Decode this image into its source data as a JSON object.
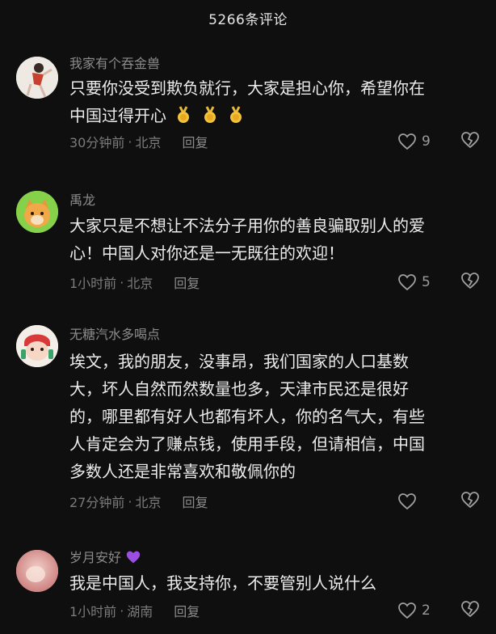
{
  "header": {
    "title": "5266条评论"
  },
  "comments": [
    {
      "username": "我家有个吞金兽",
      "lines": [
        "只要你没受到欺负就行，大家是担心你，希望你在",
        "中国过得开心"
      ],
      "time": "30分钟前",
      "location": "北京",
      "reply": "回复",
      "likes": "9",
      "emoji": "gold-medal-icon x3"
    },
    {
      "username": "禹龙",
      "lines": [
        "大家只是不想让不法分子用你的善良骗取别人的爱",
        "心！中国人对你还是一无既往的欢迎！"
      ],
      "time": "1小时前",
      "location": "北京",
      "reply": "回复",
      "likes": "5"
    },
    {
      "username": "无糖汽水多喝点",
      "lines": [
        "埃文，我的朋友，没事昂，我们国家的人口基数",
        "大，坏人自然而然数量也多，天津市民还是很好",
        "的，哪里都有好人也都有坏人，你的名气大，有些",
        "人肯定会为了赚点钱，使用手段，但请相信，中国",
        "多数人还是非常喜欢和敬佩你的"
      ],
      "time": "27分钟前",
      "location": "北京",
      "reply": "回复",
      "likes": ""
    },
    {
      "username": "岁月安好",
      "lines": [
        "我是中国人，我支持你，不要管别人说什么"
      ],
      "time": "1小时前",
      "location": "湖南",
      "reply": "回复",
      "likes": "2",
      "emoji": "purple-heart-icon"
    }
  ],
  "meta": {
    "separator": "·"
  },
  "colors": {
    "background": "#0f0f0f",
    "text": "#ececec",
    "muted": "#7b7b7b"
  }
}
